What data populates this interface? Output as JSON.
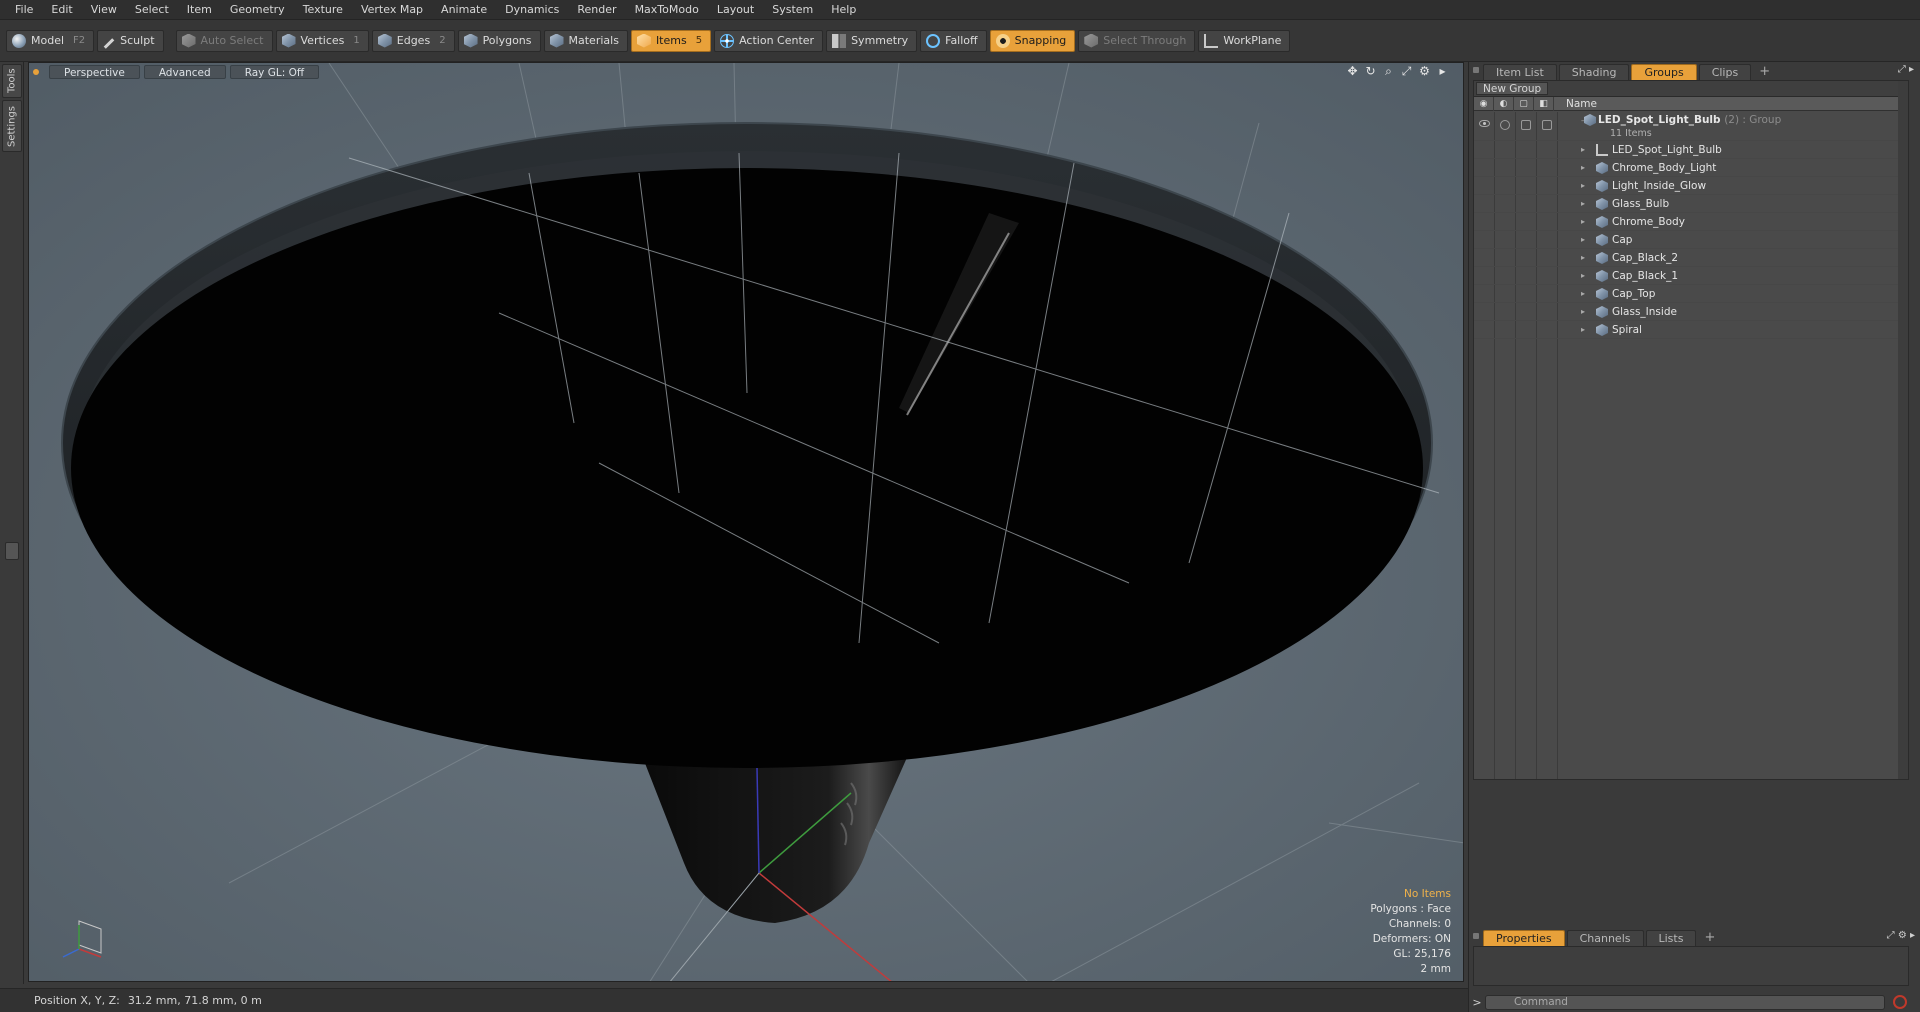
{
  "menu": [
    "File",
    "Edit",
    "View",
    "Select",
    "Item",
    "Geometry",
    "Texture",
    "Vertex Map",
    "Animate",
    "Dynamics",
    "Render",
    "MaxToModo",
    "Layout",
    "System",
    "Help"
  ],
  "toolbar": {
    "model": {
      "label": "Model",
      "key": "F2"
    },
    "sculpt": {
      "label": "Sculpt"
    },
    "auto_select": {
      "label": "Auto Select"
    },
    "vertices": {
      "label": "Vertices",
      "key": "1"
    },
    "edges": {
      "label": "Edges",
      "key": "2"
    },
    "polygons": {
      "label": "Polygons"
    },
    "materials": {
      "label": "Materials"
    },
    "items": {
      "label": "Items",
      "key": "5"
    },
    "action_center": {
      "label": "Action Center"
    },
    "symmetry": {
      "label": "Symmetry"
    },
    "falloff": {
      "label": "Falloff"
    },
    "snapping": {
      "label": "Snapping"
    },
    "select_through": {
      "label": "Select Through"
    },
    "workplane": {
      "label": "WorkPlane"
    }
  },
  "left_tabs": {
    "tools": "Tools",
    "settings": "Settings"
  },
  "viewport": {
    "view_mode": "Perspective",
    "shading": "Advanced",
    "raygl": "Ray GL: Off",
    "info": {
      "selection": "No Items",
      "polygons": "Polygons : Face",
      "channels": "Channels: 0",
      "deformers": "Deformers: ON",
      "gl": "GL: 25,176",
      "scale": "2 mm"
    },
    "accent": "#f0b24a"
  },
  "status": {
    "label": "Position X, Y, Z:",
    "value": "31.2 mm, 71.8 mm, 0 m"
  },
  "right_panel": {
    "tabs": [
      "Item List",
      "Shading",
      "Groups",
      "Clips"
    ],
    "active_tab": "Groups",
    "new_group": "New Group",
    "column_name": "Name",
    "root": {
      "name": "LED_Spot_Light_Bulb",
      "meta": "(2) : Group",
      "count": "11 Items"
    },
    "items": [
      "LED_Spot_Light_Bulb",
      "Chrome_Body_Light",
      "Light_Inside_Glow",
      "Glass_Bulb",
      "Chrome_Body",
      "Cap",
      "Cap_Black_2",
      "Cap_Black_1",
      "Cap_Top",
      "Glass_Inside",
      "Spiral"
    ],
    "bottom_tabs": [
      "Properties",
      "Channels",
      "Lists"
    ],
    "active_bottom_tab": "Properties",
    "command_placeholder": "Command"
  }
}
